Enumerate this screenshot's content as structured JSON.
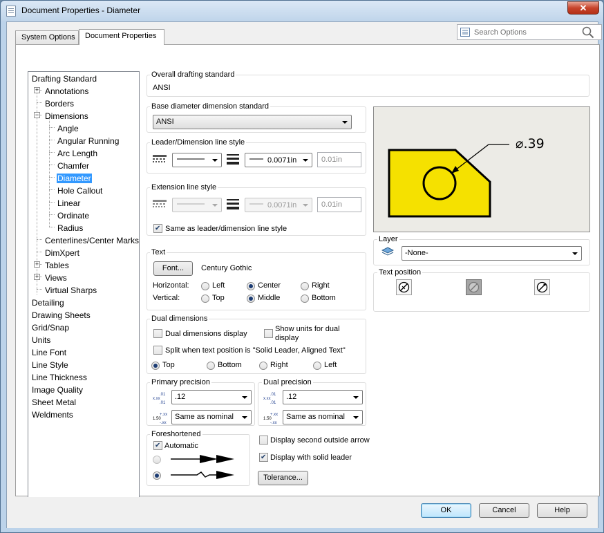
{
  "window": {
    "title": "Document Properties - Diameter",
    "close_label": "✕"
  },
  "tabs": [
    {
      "label": "System Options"
    },
    {
      "label": "Document Properties"
    }
  ],
  "search": {
    "placeholder": "Search Options"
  },
  "tree": {
    "items": [
      {
        "label": "Drafting Standard"
      },
      {
        "label": "Annotations"
      },
      {
        "label": "Borders"
      },
      {
        "label": "Dimensions"
      },
      {
        "label": "Angle"
      },
      {
        "label": "Angular Running"
      },
      {
        "label": "Arc Length"
      },
      {
        "label": "Chamfer"
      },
      {
        "label": "Diameter"
      },
      {
        "label": "Hole Callout"
      },
      {
        "label": "Linear"
      },
      {
        "label": "Ordinate"
      },
      {
        "label": "Radius"
      },
      {
        "label": "Centerlines/Center Marks"
      },
      {
        "label": "DimXpert"
      },
      {
        "label": "Tables"
      },
      {
        "label": "Views"
      },
      {
        "label": "Virtual Sharps"
      },
      {
        "label": "Detailing"
      },
      {
        "label": "Drawing Sheets"
      },
      {
        "label": "Grid/Snap"
      },
      {
        "label": "Units"
      },
      {
        "label": "Line Font"
      },
      {
        "label": "Line Style"
      },
      {
        "label": "Line Thickness"
      },
      {
        "label": "Image Quality"
      },
      {
        "label": "Sheet Metal"
      },
      {
        "label": "Weldments"
      }
    ]
  },
  "overall": {
    "label": "Overall drafting standard",
    "value": "ANSI"
  },
  "base_standard": {
    "label": "Base diameter dimension standard",
    "value": "ANSI"
  },
  "leader_style": {
    "label": "Leader/Dimension line style",
    "thickness": "0.0071in",
    "custom": "0.01in"
  },
  "extension_style": {
    "label": "Extension line style",
    "thickness": "0.0071in",
    "custom": "0.01in",
    "same_label": "Same as leader/dimension line style"
  },
  "text": {
    "label": "Text",
    "font_button": "Font...",
    "font_name": "Century Gothic",
    "horizontal_label": "Horizontal:",
    "vertical_label": "Vertical:",
    "h_left": "Left",
    "h_center": "Center",
    "h_right": "Right",
    "v_top": "Top",
    "v_middle": "Middle",
    "v_bottom": "Bottom"
  },
  "dual": {
    "label": "Dual dimensions",
    "display": "Dual dimensions display",
    "show_units_1": "Show units for dual",
    "show_units_2": "display",
    "split": "Split when text position is \"Solid Leader, Aligned Text\"",
    "top": "Top",
    "bottom": "Bottom",
    "right": "Right",
    "left": "Left"
  },
  "primary_precision": {
    "label": "Primary precision",
    "value": ".12",
    "tolerance": "Same as nominal"
  },
  "dual_precision": {
    "label": "Dual precision",
    "value": ".12",
    "tolerance": "Same as nominal"
  },
  "foreshortened": {
    "label": "Foreshortened",
    "automatic": "Automatic"
  },
  "options": {
    "second_arrow": "Display second outside arrow",
    "solid_leader": "Display with solid leader",
    "tolerance_button": "Tolerance..."
  },
  "preview": {
    "dimension_text": "⌀.39"
  },
  "layer": {
    "label": "Layer",
    "value": "-None-"
  },
  "text_position": {
    "label": "Text position"
  },
  "footer": {
    "ok": "OK",
    "cancel": "Cancel",
    "help": "Help"
  },
  "colors": {
    "preview_bg": "#ecebe6",
    "part_fill": "#f5e100",
    "selection": "#3399ff"
  }
}
